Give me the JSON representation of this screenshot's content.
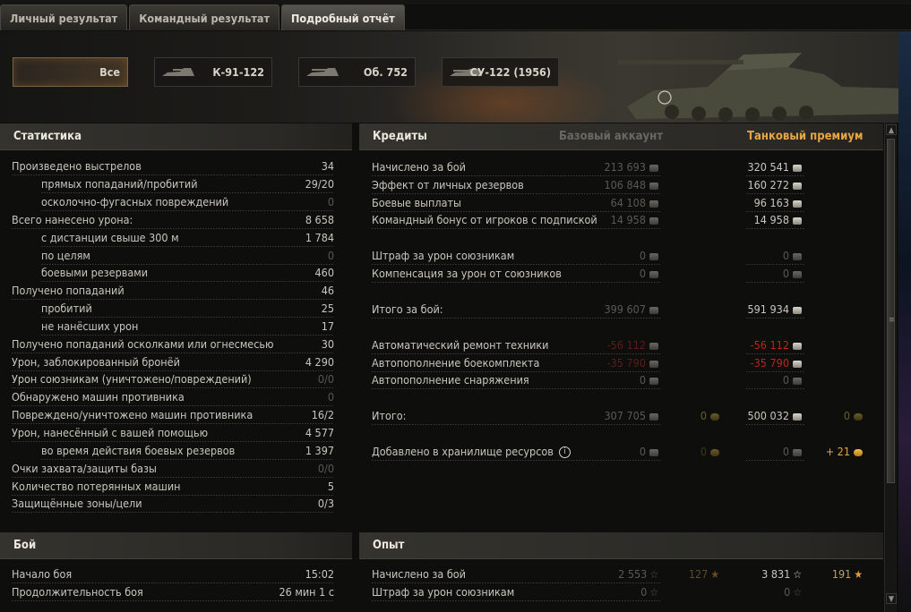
{
  "tabs": [
    {
      "label": "Личный результат"
    },
    {
      "label": "Командный результат"
    },
    {
      "label": "Подробный отчёт"
    }
  ],
  "vehicles": [
    {
      "label": "Все"
    },
    {
      "label": "К-91-122"
    },
    {
      "label": "Об. 752"
    },
    {
      "label": "СУ-122 (1956)"
    }
  ],
  "stats": {
    "title": "Статистика",
    "rows": [
      {
        "label": "Произведено выстрелов",
        "value": "34"
      },
      {
        "label": "прямых попаданий/пробитий",
        "value": "29/20"
      },
      {
        "label": "осколочно-фугасных повреждений",
        "value": "0"
      },
      {
        "label": "Всего нанесено урона:",
        "value": "8 658"
      },
      {
        "label": "с дистанции свыше 300 м",
        "value": "1 784"
      },
      {
        "label": "по целям",
        "value": "0"
      },
      {
        "label": "боевыми резервами",
        "value": "460"
      },
      {
        "label": "Получено попаданий",
        "value": "46"
      },
      {
        "label": "пробитий",
        "value": "25"
      },
      {
        "label": "не нанёсших урон",
        "value": "17"
      },
      {
        "label": "Получено попаданий осколками или огнесмесью",
        "value": "30"
      },
      {
        "label": "Урон, заблокированный бронёй",
        "value": "4 290"
      },
      {
        "label": "Урон союзникам (уничтожено/повреждений)",
        "value": "0/0"
      },
      {
        "label": "Обнаружено машин противника",
        "value": "0"
      },
      {
        "label": "Повреждено/уничтожено машин противника",
        "value": "16/2"
      },
      {
        "label": "Урон, нанесённый с вашей помощью",
        "value": "4 577"
      },
      {
        "label": "во время действия боевых резервов",
        "value": "1 397"
      },
      {
        "label": "Очки захвата/защиты базы",
        "value": "0/0"
      },
      {
        "label": "Количество потерянных машин",
        "value": "5"
      },
      {
        "label": "Защищённые зоны/цели",
        "value": "0/3"
      }
    ]
  },
  "credits": {
    "title": "Кредиты",
    "col_base": "Базовый аккаунт",
    "col_premium": "Танковый премиум",
    "rows": [
      {
        "label": "Начислено за бой",
        "base": "213 693",
        "prem": "320 541"
      },
      {
        "label": "Эффект от личных резервов",
        "base": "106 848",
        "prem": "160 272"
      },
      {
        "label": "Боевые выплаты",
        "base": "64 108",
        "prem": "96 163"
      },
      {
        "label": "Командный бонус от игроков с подпиской",
        "base": "14 958",
        "prem": "14 958"
      },
      {
        "label": "Штраф за урон союзникам",
        "base": "0",
        "prem": "0"
      },
      {
        "label": "Компенсация за урон от союзников",
        "base": "0",
        "prem": "0"
      },
      {
        "label": "Итого за бой:",
        "base": "399 607",
        "prem": "591 934"
      },
      {
        "label": "Автоматический ремонт техники",
        "base": "-56 112",
        "prem": "-56 112"
      },
      {
        "label": "Автопополнение боекомплекта",
        "base": "-35 790",
        "prem": "-35 790"
      },
      {
        "label": "Автопополнение снаряжения",
        "base": "0",
        "prem": "0"
      },
      {
        "label": "Итого:",
        "base": "307 705",
        "base_gold": "0",
        "prem": "500 032",
        "prem_gold": "0"
      },
      {
        "label": "Добавлено в хранилище ресурсов",
        "base": "0",
        "base_gold": "0",
        "prem": "0",
        "prem_gold": "+ 21"
      }
    ]
  },
  "battle": {
    "title": "Бой",
    "rows": [
      {
        "label": "Начало боя",
        "value": "15:02"
      },
      {
        "label": "Продолжительность боя",
        "value": "26 мин 1 с"
      }
    ]
  },
  "xp": {
    "title": "Опыт",
    "rows": [
      {
        "label": "Начислено за бой",
        "base": "2 553",
        "base_free": "127",
        "prem": "3 831",
        "prem_free": "191"
      },
      {
        "label": "Штраф за урон союзникам",
        "base": "0",
        "prem": "0"
      }
    ]
  },
  "icons": {
    "credit": "credit-icon",
    "gold": "gold-icon",
    "xp": "xp-star-icon",
    "free_xp": "free-xp-star-icon",
    "info": "info-icon"
  },
  "colors": {
    "accent": "#e8a544",
    "negative": "#c0221c",
    "panel_header": "#34332e"
  }
}
